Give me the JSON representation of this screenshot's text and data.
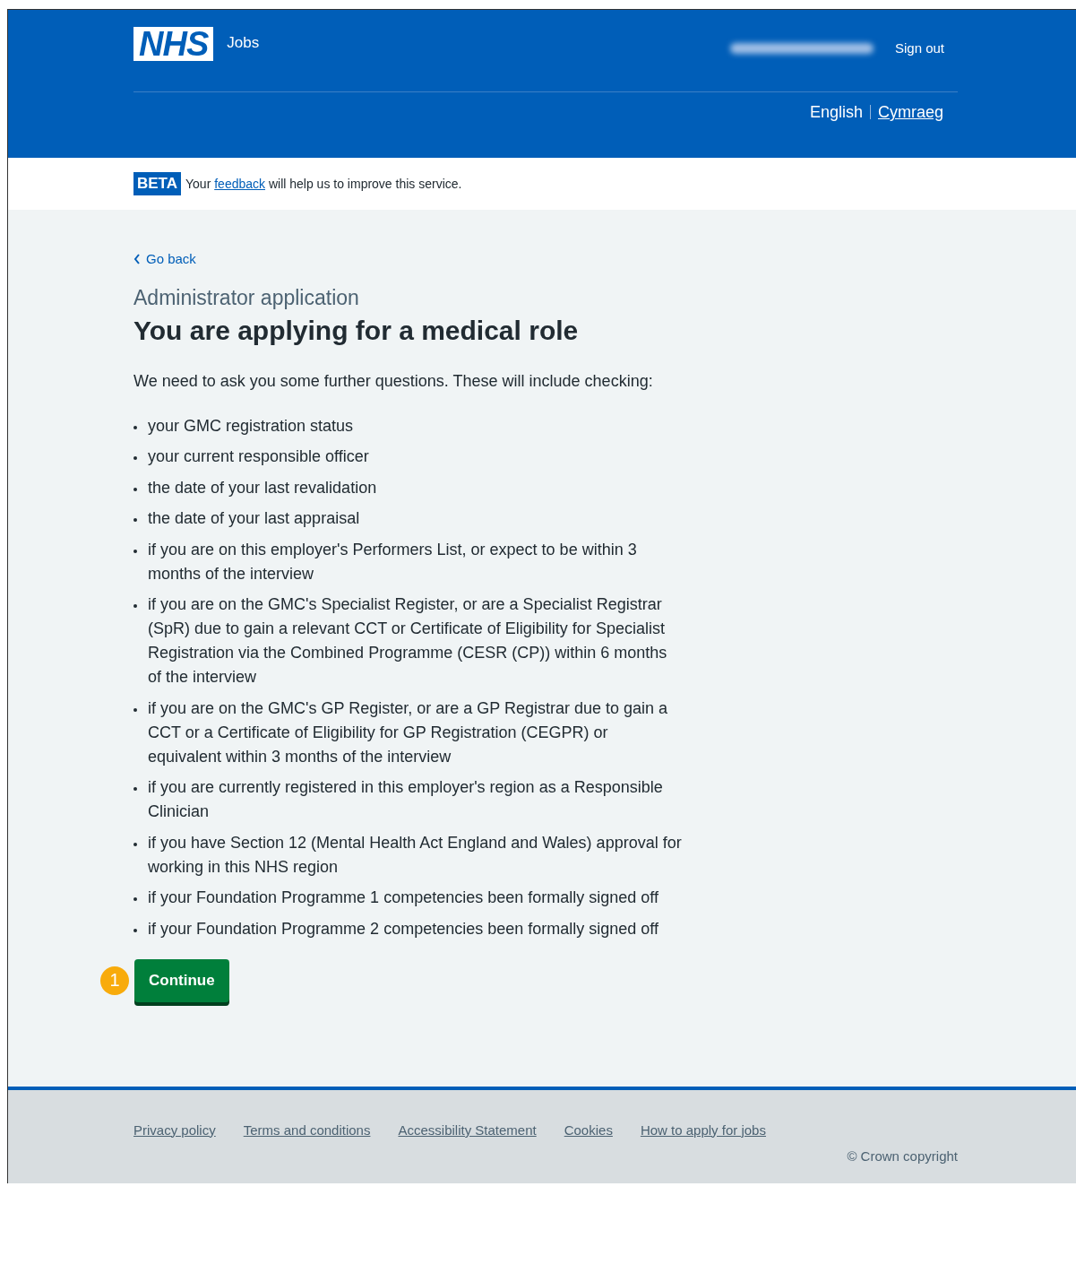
{
  "header": {
    "logo": "NHS",
    "service": "Jobs",
    "sign_out": "Sign out",
    "languages": [
      {
        "label": "English",
        "selected": true
      },
      {
        "label": "Cymraeg",
        "selected": false
      }
    ]
  },
  "beta_banner": {
    "tag": "BETA",
    "link": "feedback",
    "before": "Your",
    "after": "will help us to improve this service."
  },
  "back_link": "Go back",
  "caption": "Administrator application",
  "heading": "You are applying for a medical role",
  "intro": "We need to ask you some further questions. These will include checking:",
  "bullets": [
    "your GMC registration status",
    "your current responsible officer",
    "the date of your last revalidation",
    "the date of your last appraisal",
    "if you are on this employer's Performers List, or expect to be within 3 months of the interview",
    "if you are on the GMC's Specialist Register, or are a Specialist Registrar (SpR) due to gain a relevant CCT or Certificate of Eligibility for Specialist Registration via the Combined Programme (CESR (CP)) within 6 months of the interview",
    "if you are on the GMC's GP Register, or are a GP Registrar due to gain a CCT or a Certificate of Eligibility for GP Registration (CEGPR) or equivalent within 3 months of the interview",
    "if you are currently registered in this employer's region as a Responsible Clinician",
    "if you have Section 12 (Mental Health Act England and Wales) approval for working in this NHS region",
    "if your Foundation Programme 1 competencies been formally signed off",
    "if your Foundation Programme 2 competencies been formally signed off"
  ],
  "step_marker": "1",
  "continue_button": "Continue",
  "footer": {
    "links": [
      "Privacy policy",
      "Terms and conditions",
      "Accessibility Statement",
      "Cookies",
      "How to apply for jobs"
    ],
    "copyright": "© Crown copyright"
  }
}
